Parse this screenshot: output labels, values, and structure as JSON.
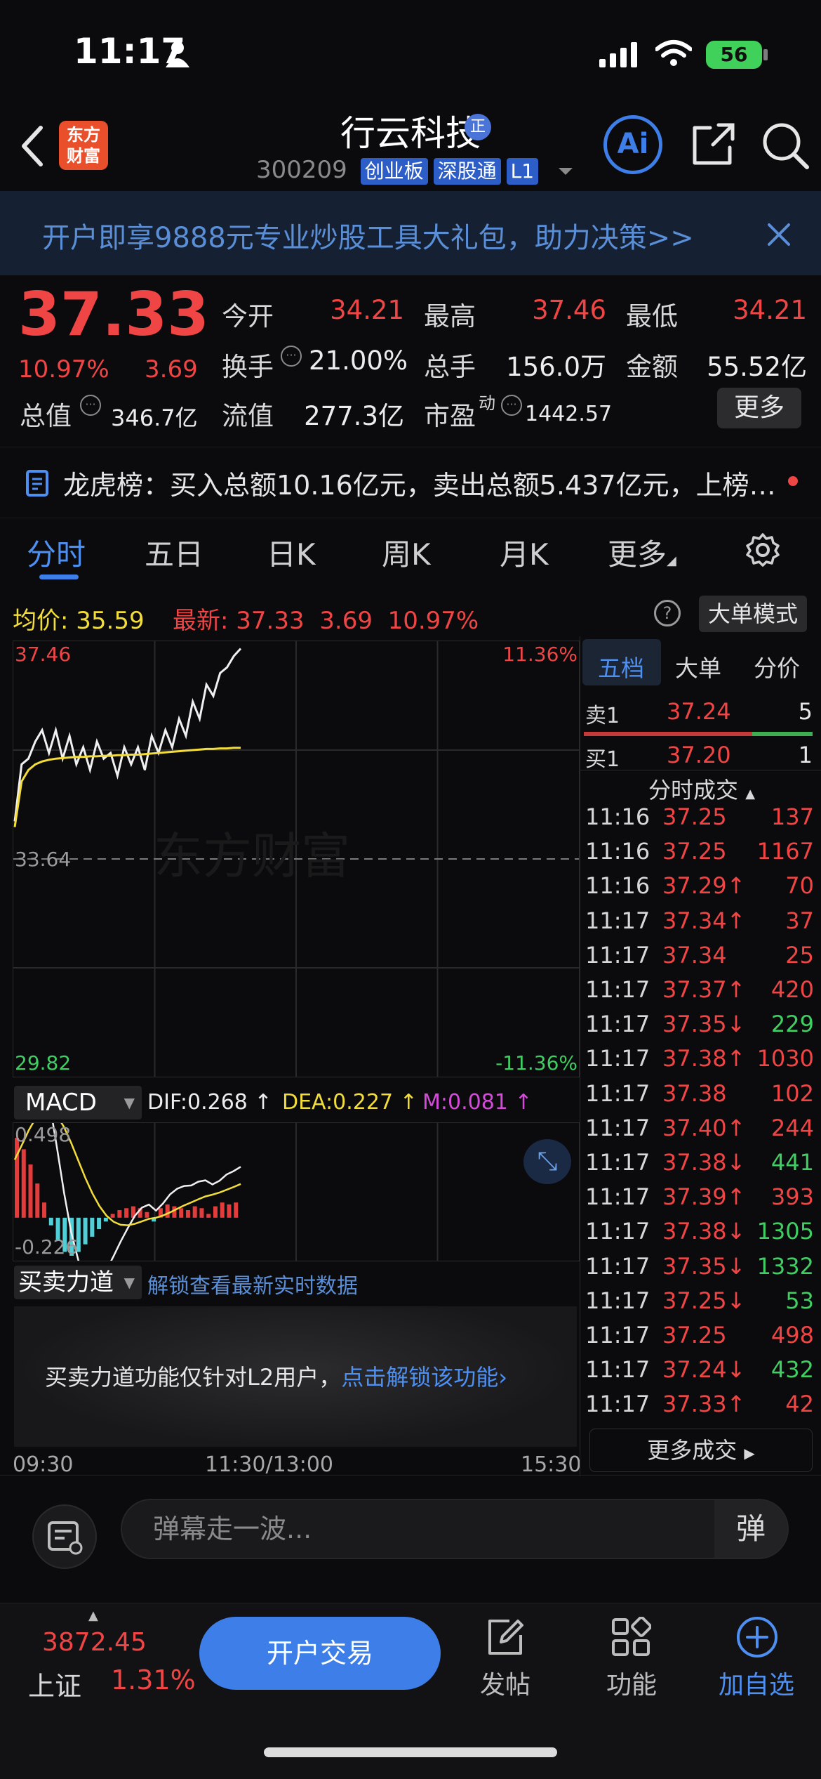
{
  "status": {
    "time": "11:17",
    "battery": "56"
  },
  "header": {
    "stock_name": "行云科技",
    "badge": "正",
    "code": "300209",
    "tags": [
      "创业板",
      "深股通",
      "L1"
    ],
    "logo": [
      "东方",
      "财富"
    ],
    "ai_label": "Ai"
  },
  "banner": {
    "text": "开户即享9888元专业炒股工具大礼包，助力决策>>"
  },
  "quote": {
    "price": "37.33",
    "pct": "10.97%",
    "chg": "3.69",
    "open_label": "今开",
    "open": "34.21",
    "high_label": "最高",
    "high": "37.46",
    "low_label": "最低",
    "low": "34.21",
    "turnover_label": "换手",
    "turnover": "21.00%",
    "volume_label": "总手",
    "volume": "156.0万",
    "amount_label": "金额",
    "amount": "55.52亿",
    "mktcap_label": "总值",
    "mktcap": "346.7亿",
    "float_label": "流值",
    "float": "277.3亿",
    "pe_label": "市盈",
    "pe_sup": "动",
    "pe": "1442.57",
    "more": "更多"
  },
  "dragon": {
    "text": "龙虎榜：买入总额10.16亿元，卖出总额5.437亿元，上榜…"
  },
  "tabs": [
    "分时",
    "五日",
    "日K",
    "周K",
    "月K",
    "更多"
  ],
  "chart_info": {
    "avg_label": "均价:",
    "avg": "35.59",
    "latest_label": "最新:",
    "latest": "37.33",
    "chg": "3.69",
    "pct": "10.97%",
    "big_order_btn": "大单模式"
  },
  "chart_data": {
    "type": "line",
    "ylim": [
      29.82,
      37.46
    ],
    "y_left_labels": [
      "37.46",
      "33.64",
      "29.82"
    ],
    "y_right_labels": [
      "11.36%",
      "-11.36%"
    ],
    "x_labels": [
      "09:30",
      "11:30/13:00",
      "15:30"
    ],
    "series": [
      {
        "values": [
          34.3,
          35.3,
          35.4,
          35.7,
          35.9,
          35.5,
          35.9,
          35.4,
          35.8,
          35.3,
          35.6,
          35.2,
          35.7,
          35.4,
          35.5,
          35.1,
          35.6,
          35.3,
          35.6,
          35.2,
          35.8,
          35.5,
          35.9,
          35.6,
          36.1,
          35.8,
          36.4,
          36.1,
          36.7,
          36.5,
          36.9,
          37.0,
          37.2,
          37.33
        ]
      },
      {
        "values": [
          34.2,
          35.0,
          35.2,
          35.3,
          35.35,
          35.38,
          35.4,
          35.41,
          35.42,
          35.43,
          35.43,
          35.44,
          35.44,
          35.45,
          35.45,
          35.46,
          35.46,
          35.47,
          35.47,
          35.48,
          35.49,
          35.5,
          35.51,
          35.52,
          35.53,
          35.54,
          35.55,
          35.56,
          35.57,
          35.57,
          35.58,
          35.58,
          35.59,
          35.59
        ]
      }
    ]
  },
  "watermark": "东方财富",
  "macd": {
    "label": "MACD",
    "dif_label": "DIF:",
    "dif": "0.268 ↑",
    "dea_label": "DEA:",
    "dea": "0.227 ↑",
    "m_label": "M:",
    "m": "0.081 ↑",
    "top": "0.498",
    "bottom": "-0.226",
    "hist": [
      0.42,
      0.36,
      0.28,
      0.18,
      0.08,
      -0.04,
      -0.12,
      -0.18,
      -0.2,
      -0.18,
      -0.14,
      -0.1,
      -0.06,
      -0.02,
      0.02,
      0.04,
      0.05,
      0.06,
      0.05,
      0.03,
      -0.02,
      0.05,
      0.07,
      0.06,
      0.05,
      0.04,
      0.06,
      0.05,
      0.02,
      0.06,
      0.08,
      0.07,
      0.08
    ]
  },
  "force": {
    "label": "买卖力道",
    "unlock": "解锁查看最新实时数据",
    "lock_text": "买卖力道功能仅针对L2用户，",
    "lock_link": "点击解锁该功能"
  },
  "orderbook": {
    "tabs": [
      "五档",
      "大单",
      "分价"
    ],
    "sell": {
      "label": "卖1",
      "price": "37.24",
      "vol": "5"
    },
    "buy": {
      "label": "买1",
      "price": "37.20",
      "vol": "1"
    },
    "ticks_title": "分时成交",
    "ticks": [
      {
        "t": "11:16",
        "p": "37.25",
        "v": "137",
        "c": "red"
      },
      {
        "t": "11:16",
        "p": "37.25",
        "v": "1167",
        "c": "red"
      },
      {
        "t": "11:16",
        "p": "37.29↑",
        "v": "70",
        "c": "red"
      },
      {
        "t": "11:17",
        "p": "37.34↑",
        "v": "37",
        "c": "red"
      },
      {
        "t": "11:17",
        "p": "37.34",
        "v": "25",
        "c": "red"
      },
      {
        "t": "11:17",
        "p": "37.37↑",
        "v": "420",
        "c": "red"
      },
      {
        "t": "11:17",
        "p": "37.35↓",
        "v": "229",
        "c": "green"
      },
      {
        "t": "11:17",
        "p": "37.38↑",
        "v": "1030",
        "c": "red"
      },
      {
        "t": "11:17",
        "p": "37.38",
        "v": "102",
        "c": "red"
      },
      {
        "t": "11:17",
        "p": "37.40↑",
        "v": "244",
        "c": "red"
      },
      {
        "t": "11:17",
        "p": "37.38↓",
        "v": "441",
        "c": "green"
      },
      {
        "t": "11:17",
        "p": "37.39↑",
        "v": "393",
        "c": "red"
      },
      {
        "t": "11:17",
        "p": "37.38↓",
        "v": "1305",
        "c": "green"
      },
      {
        "t": "11:17",
        "p": "37.35↓",
        "v": "1332",
        "c": "green"
      },
      {
        "t": "11:17",
        "p": "37.25↓",
        "v": "53",
        "c": "green"
      },
      {
        "t": "11:17",
        "p": "37.25",
        "v": "498",
        "c": "red"
      },
      {
        "t": "11:17",
        "p": "37.24↓",
        "v": "432",
        "c": "green"
      },
      {
        "t": "11:17",
        "p": "37.33↑",
        "v": "42",
        "c": "red"
      }
    ],
    "more": "更多成交"
  },
  "comment": {
    "placeholder": "弹幕走一波...",
    "bullet": "弹"
  },
  "bottom": {
    "index_value": "3872.45",
    "index_name": "上证",
    "index_pct": "1.31%",
    "open_trade": "开户交易",
    "nav": [
      "发帖",
      "功能",
      "加自选"
    ]
  },
  "colors": {
    "up": "#f04545",
    "down": "#3fce62",
    "accent": "#4e8ff2",
    "avg": "#f2dd3a"
  }
}
